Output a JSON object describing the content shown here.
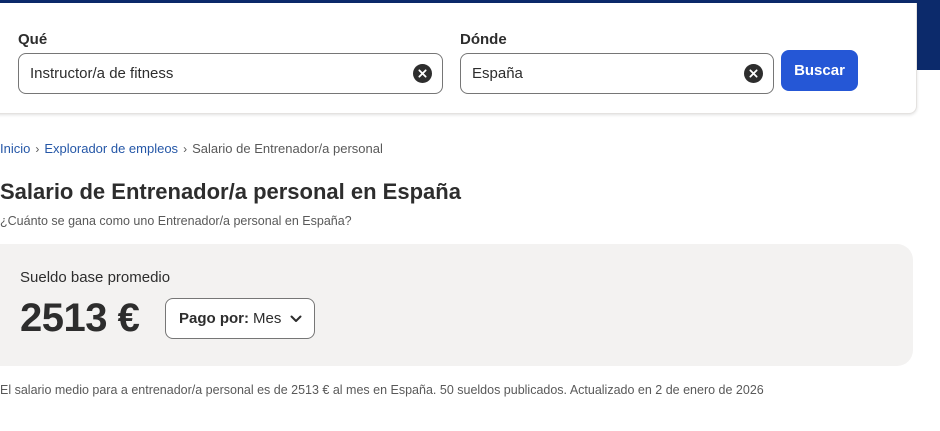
{
  "search": {
    "what_label": "Qué",
    "what_value": "Instructor/a de fitness",
    "where_label": "Dónde",
    "where_value": "España",
    "button_label": "Buscar"
  },
  "breadcrumb": {
    "items": [
      "Inicio",
      "Explorador de empleos"
    ],
    "current": "Salario de Entrenador/a personal",
    "separator": "›"
  },
  "page": {
    "title": "Salario de Entrenador/a personal en España",
    "subtitle": "¿Cuánto se gana como uno Entrenador/a personal en España?"
  },
  "salary": {
    "label": "Sueldo base promedio",
    "amount": "2513 €",
    "pay_label": "Pago por:",
    "pay_value": "Mes"
  },
  "footnote": "El salario medio para a entrenador/a personal es de 2513 € al mes en España.  50 sueldos publicados. Actualizado en 2 de enero de 2026",
  "colors": {
    "accent": "#2557d6",
    "link": "#2557a7",
    "header_band": "#0c2a6b",
    "card_bg": "#f3f2f1"
  },
  "icons": [
    "clear-icon",
    "chevron-right-icon",
    "chevron-down-icon"
  ]
}
